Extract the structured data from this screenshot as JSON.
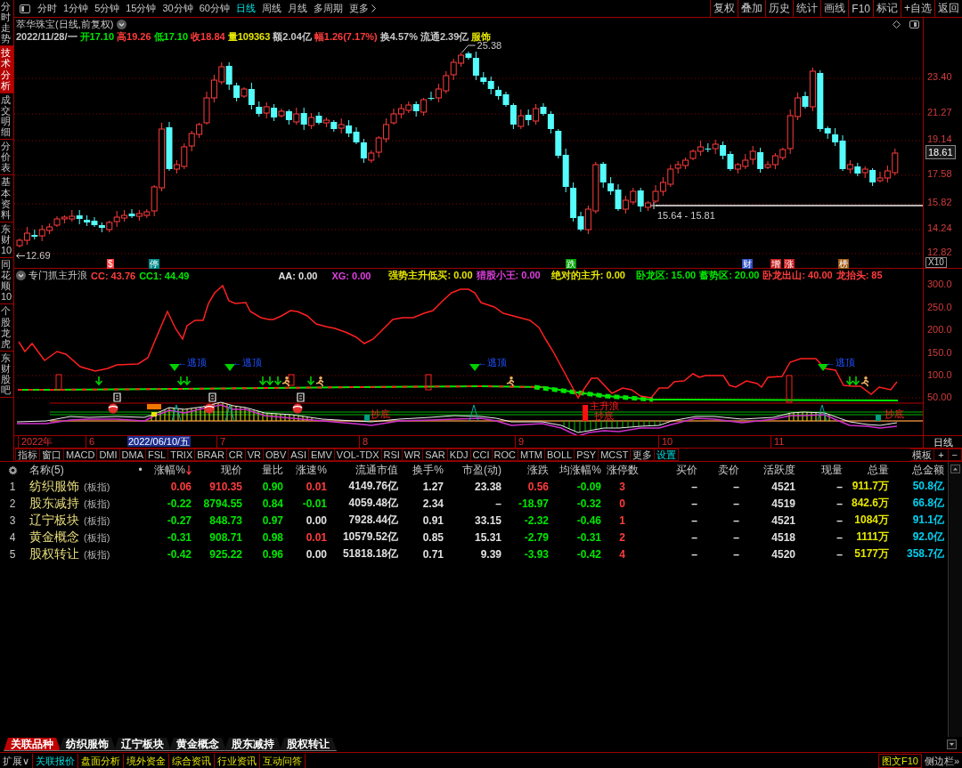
{
  "toolbar": {
    "periods": [
      {
        "label": "分时",
        "selected": false
      },
      {
        "label": "1分钟",
        "selected": false
      },
      {
        "label": "5分钟",
        "selected": false
      },
      {
        "label": "15分钟",
        "selected": false
      },
      {
        "label": "30分钟",
        "selected": false
      },
      {
        "label": "60分钟",
        "selected": false
      },
      {
        "label": "日线",
        "selected": true
      },
      {
        "label": "周线",
        "selected": false
      },
      {
        "label": "月线",
        "selected": false
      },
      {
        "label": "多周期",
        "selected": false
      }
    ],
    "more": "更多",
    "buttons": [
      "复权",
      "叠加",
      "历史",
      "统计",
      "画线",
      "F10",
      "标记",
      "+自选",
      "返回"
    ]
  },
  "sidebar": {
    "tabs": [
      {
        "label": "分时走势",
        "selected": false
      },
      {
        "label": "技术分析",
        "selected": true
      },
      {
        "label": "成交明细",
        "selected": false
      },
      {
        "label": "分价表",
        "selected": false
      },
      {
        "label": "基本资料",
        "selected": false
      },
      {
        "label": "东财10",
        "selected": false
      },
      {
        "label": "同花顺10",
        "selected": false
      },
      {
        "label": "个股龙虎",
        "selected": false
      },
      {
        "label": "东财股吧",
        "selected": false
      }
    ]
  },
  "chart": {
    "title": "萃华珠宝(日线,前复权)",
    "quote": [
      {
        "text": "2022/11/28/一",
        "color": "#c8c8c8"
      },
      {
        "text": "开17.10",
        "color": "#00e600"
      },
      {
        "text": "高19.26",
        "color": "#ff3c3c"
      },
      {
        "text": "低17.10",
        "color": "#00e600"
      },
      {
        "text": "收18.84",
        "color": "#ff3c3c"
      },
      {
        "text": "量109363",
        "color": "#e6e600"
      },
      {
        "text": "额2.04亿",
        "color": "#c8c8c8"
      },
      {
        "text": "幅1.26(7.17%)",
        "color": "#ff3c3c"
      },
      {
        "text": "换4.57%",
        "color": "#c8c8c8"
      },
      {
        "text": "流通2.39亿",
        "color": "#c8c8c8"
      },
      {
        "text": "服饰",
        "color": "#e6e600"
      }
    ],
    "high_label": "25.38",
    "low_label": "12.69",
    "range_label": "15.64 - 15.81",
    "events": [
      {
        "text": "$",
        "color": "#ff3c3c"
      },
      {
        "text": "停",
        "color": "#008c8c"
      },
      {
        "text": "跌",
        "color": "#00a000"
      },
      {
        "text": "财",
        "color": "#3050c8"
      },
      {
        "text": "增",
        "color": "#c81e1e"
      },
      {
        "text": "涨",
        "color": "#c81e1e"
      },
      {
        "text": "榜",
        "color": "#a05a14"
      }
    ],
    "price_axis": [
      "23.40",
      "21.27",
      "19.14",
      "17.58",
      "15.82",
      "14.24",
      "12.82"
    ],
    "current_price": "18.61",
    "scale": "X10"
  },
  "indicator": {
    "name": "专门抓主升浪",
    "values": [
      {
        "text": "CC: 43.76",
        "color": "#ff3c3c"
      },
      {
        "text": "CC1: 44.49",
        "color": "#00e600"
      },
      {
        "text": "AA: 0.00",
        "color": "#e0e0e0"
      },
      {
        "text": "XG: 0.00",
        "color": "#e040e0"
      },
      {
        "text": "强势主升低买: 0.00",
        "color": "#e6e600"
      },
      {
        "text": "猎股小王: 0.00",
        "color": "#e040e0"
      },
      {
        "text": "绝对的主升: 0.00",
        "color": "#e6e600"
      },
      {
        "text": "卧龙区: 15.00",
        "color": "#00e600"
      },
      {
        "text": "蓄势区: 20.00",
        "color": "#00e600"
      },
      {
        "text": "卧龙出山: 40.00",
        "color": "#ff3c3c"
      },
      {
        "text": "龙抬头: 85",
        "color": "#ff3c3c"
      }
    ],
    "axis": [
      "300.0",
      "250.0",
      "200.0",
      "150.0",
      "100.0",
      "50.00"
    ],
    "signals": [
      {
        "text": "←逃顶"
      },
      {
        "text": "←逃顶"
      },
      {
        "text": "←逃顶"
      },
      {
        "text": "←逃顶"
      }
    ],
    "annotations": [
      {
        "text": "抄底"
      },
      {
        "text": "主升浪"
      },
      {
        "text": "抄底"
      },
      {
        "text": "抄底"
      }
    ]
  },
  "date_axis": {
    "labels": [
      "2022年",
      "6",
      "7",
      "8",
      "9",
      "10",
      "11"
    ],
    "cursor_date": "2022/06/10/五",
    "period": "日线"
  },
  "indicator_tabs": {
    "tabs": [
      "指标",
      "窗口",
      "MACD",
      "DMI",
      "DMA",
      "FSL",
      "TRIX",
      "BRAR",
      "CR",
      "VR",
      "OBV",
      "ASI",
      "EMV",
      "VOL-TDX",
      "RSI",
      "WR",
      "SAR",
      "KDJ",
      "CCI",
      "ROC",
      "MTM",
      "BOLL",
      "PSY",
      "MCST",
      "更多"
    ],
    "settings": "设置",
    "template": "模板",
    "add": "+",
    "remove": "−"
  },
  "table": {
    "name_header": "名称(5)",
    "marker_header": "•",
    "columns": [
      {
        "label": "涨幅%",
        "sorted": true
      },
      {
        "label": "现价",
        "sorted": false
      },
      {
        "label": "量比",
        "sorted": false
      },
      {
        "label": "涨速%",
        "sorted": false
      },
      {
        "label": "流通市值",
        "sorted": false
      },
      {
        "label": "换手%",
        "sorted": false
      },
      {
        "label": "市盈(动)",
        "sorted": false
      },
      {
        "label": "涨跌",
        "sorted": false
      },
      {
        "label": "均涨幅%",
        "sorted": false
      },
      {
        "label": "涨停数",
        "sorted": false
      },
      {
        "label": "买价",
        "sorted": false
      },
      {
        "label": "卖价",
        "sorted": false
      },
      {
        "label": "活跃度",
        "sorted": false
      },
      {
        "label": "现量",
        "sorted": false
      },
      {
        "label": "总量",
        "sorted": false
      },
      {
        "label": "总金额",
        "sorted": false
      }
    ],
    "rows": [
      {
        "index": "1",
        "name": "纺织服饰",
        "type": "(板指)",
        "cells": [
          {
            "text": "0.06",
            "color": "#ff3c3c"
          },
          {
            "text": "910.35",
            "color": "#ff3c3c"
          },
          {
            "text": "0.90",
            "color": "#00e600"
          },
          {
            "text": "0.01",
            "color": "#ff3c3c"
          },
          {
            "text": "4149.76亿",
            "color": "#e0e0e0"
          },
          {
            "text": "1.27",
            "color": "#e0e0e0"
          },
          {
            "text": "23.38",
            "color": "#e0e0e0"
          },
          {
            "text": "0.56",
            "color": "#ff3c3c"
          },
          {
            "text": "-0.09",
            "color": "#00e600"
          },
          {
            "text": "3",
            "color": "#ff3c3c"
          },
          {
            "text": "–"
          },
          {
            "text": "–"
          },
          {
            "text": "4521",
            "color": "#e0e0e0"
          },
          {
            "text": "–"
          },
          {
            "text": "911.7万",
            "color": "#e6e600"
          },
          {
            "text": "50.8亿",
            "color": "#00d0f0"
          }
        ]
      },
      {
        "index": "2",
        "name": "股东减持",
        "type": "(板指)",
        "cells": [
          {
            "text": "-0.22",
            "color": "#00e600"
          },
          {
            "text": "8794.55",
            "color": "#00e600"
          },
          {
            "text": "0.84",
            "color": "#00e600"
          },
          {
            "text": "-0.01",
            "color": "#00e600"
          },
          {
            "text": "4059.48亿",
            "color": "#e0e0e0"
          },
          {
            "text": "2.34",
            "color": "#e0e0e0"
          },
          {
            "text": "–"
          },
          {
            "text": "-18.97",
            "color": "#00e600"
          },
          {
            "text": "-0.32",
            "color": "#00e600"
          },
          {
            "text": "0",
            "color": "#ff3c3c"
          },
          {
            "text": "–"
          },
          {
            "text": "–"
          },
          {
            "text": "4519",
            "color": "#e0e0e0"
          },
          {
            "text": "–"
          },
          {
            "text": "842.6万",
            "color": "#e6e600"
          },
          {
            "text": "66.8亿",
            "color": "#00d0f0"
          }
        ]
      },
      {
        "index": "3",
        "name": "辽宁板块",
        "type": "(板指)",
        "cells": [
          {
            "text": "-0.27",
            "color": "#00e600"
          },
          {
            "text": "848.73",
            "color": "#00e600"
          },
          {
            "text": "0.97",
            "color": "#00e600"
          },
          {
            "text": "0.00",
            "color": "#e0e0e0"
          },
          {
            "text": "7928.44亿",
            "color": "#e0e0e0"
          },
          {
            "text": "0.91",
            "color": "#e0e0e0"
          },
          {
            "text": "33.15",
            "color": "#e0e0e0"
          },
          {
            "text": "-2.32",
            "color": "#00e600"
          },
          {
            "text": "-0.46",
            "color": "#00e600"
          },
          {
            "text": "1",
            "color": "#ff3c3c"
          },
          {
            "text": "–"
          },
          {
            "text": "–"
          },
          {
            "text": "4521",
            "color": "#e0e0e0"
          },
          {
            "text": "–"
          },
          {
            "text": "1084万",
            "color": "#e6e600"
          },
          {
            "text": "91.1亿",
            "color": "#00d0f0"
          }
        ]
      },
      {
        "index": "4",
        "name": "黄金概念",
        "type": "(板指)",
        "cells": [
          {
            "text": "-0.31",
            "color": "#00e600"
          },
          {
            "text": "908.71",
            "color": "#00e600"
          },
          {
            "text": "0.98",
            "color": "#00e600"
          },
          {
            "text": "0.01",
            "color": "#ff3c3c"
          },
          {
            "text": "10579.52亿",
            "color": "#e0e0e0"
          },
          {
            "text": "0.85",
            "color": "#e0e0e0"
          },
          {
            "text": "15.31",
            "color": "#e0e0e0"
          },
          {
            "text": "-2.79",
            "color": "#00e600"
          },
          {
            "text": "-0.31",
            "color": "#00e600"
          },
          {
            "text": "2",
            "color": "#ff3c3c"
          },
          {
            "text": "–"
          },
          {
            "text": "–"
          },
          {
            "text": "4518",
            "color": "#e0e0e0"
          },
          {
            "text": "–"
          },
          {
            "text": "1111万",
            "color": "#e6e600"
          },
          {
            "text": "92.0亿",
            "color": "#00d0f0"
          }
        ]
      },
      {
        "index": "5",
        "name": "股权转让",
        "type": "(板指)",
        "cells": [
          {
            "text": "-0.42",
            "color": "#00e600"
          },
          {
            "text": "925.22",
            "color": "#00e600"
          },
          {
            "text": "0.96",
            "color": "#00e600"
          },
          {
            "text": "0.00",
            "color": "#e0e0e0"
          },
          {
            "text": "51818.18亿",
            "color": "#e0e0e0"
          },
          {
            "text": "0.71",
            "color": "#e0e0e0"
          },
          {
            "text": "9.39",
            "color": "#e0e0e0"
          },
          {
            "text": "-3.93",
            "color": "#00e600"
          },
          {
            "text": "-0.42",
            "color": "#00e600"
          },
          {
            "text": "4",
            "color": "#ff3c3c"
          },
          {
            "text": "–"
          },
          {
            "text": "–"
          },
          {
            "text": "4520",
            "color": "#e0e0e0"
          },
          {
            "text": "–"
          },
          {
            "text": "5177万",
            "color": "#e6e600"
          },
          {
            "text": "358.7亿",
            "color": "#00d0f0"
          }
        ]
      }
    ]
  },
  "bottom_tabs": [
    {
      "label": "关联品种",
      "selected": true
    },
    {
      "label": "纺织服饰",
      "selected": false
    },
    {
      "label": "辽宁板块",
      "selected": false
    },
    {
      "label": "黄金概念",
      "selected": false
    },
    {
      "label": "股东减持",
      "selected": false
    },
    {
      "label": "股权转让",
      "selected": false
    }
  ],
  "bottom_bar": {
    "expand": "扩展∨",
    "items": [
      {
        "label": "关联报价",
        "selected": true
      },
      {
        "label": "盘面分析",
        "selected": false
      },
      {
        "label": "境外资金",
        "selected": false
      },
      {
        "label": "综合资讯",
        "selected": false
      },
      {
        "label": "行业资讯",
        "selected": false
      },
      {
        "label": "互动问答",
        "selected": false
      }
    ],
    "f10": "图文F10",
    "sidebar_toggle": "侧边栏»"
  }
}
